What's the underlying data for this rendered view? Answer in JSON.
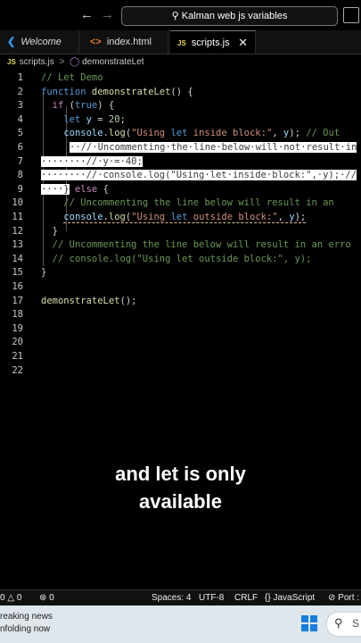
{
  "titlebar": {
    "back_icon": "arrow-left-icon",
    "forward_icon": "arrow-right-icon",
    "search_text": "Kalman web js variables"
  },
  "tabs": [
    {
      "label": "Welcome",
      "icon": "vscode-icon"
    },
    {
      "label": "index.html",
      "icon": "html-file-icon"
    },
    {
      "label": "scripts.js",
      "icon": "js-file-icon",
      "active": true
    }
  ],
  "breadcrumb": {
    "file": "scripts.js",
    "symbol": "demonstrateLet",
    "separator": ">"
  },
  "code_lines": [
    "// Let Demo",
    "function demonstrateLet() {",
    "if (true) {",
    "let y = 20;",
    "console.log(\"Using let inside block:\", y); // Out",
    "// Uncommenting the line below will not result in",
    "// y = 40;",
    "// console.log(\"Using let inside block:\", y); //",
    "} else {",
    "// Uncommenting the line below will result in an",
    "console.log(\"Using let outside block:\", y);",
    "}",
    "// Uncommenting the line below will result in an erro",
    "// console.log(\"Using let outside block:\", y);",
    "}",
    "",
    "demonstrateLet();",
    "",
    "",
    "",
    "",
    ""
  ],
  "line_numbers": [
    "1",
    "2",
    "3",
    "4",
    "5",
    "6",
    "7",
    "8",
    "9",
    "10",
    "11",
    "12",
    "13",
    "14",
    "15",
    "16",
    "17",
    "18",
    "19",
    "20",
    "21",
    "22"
  ],
  "caption": {
    "line1": "and let is only",
    "line2": "available"
  },
  "status": {
    "errors": "0",
    "warnings": "0",
    "ports": "0",
    "spaces": "Spaces: 4",
    "encoding": "UTF-8",
    "eol": "CRLF",
    "language": "JavaScript",
    "port": "Port :"
  },
  "taskbar": {
    "news_line1": "reaking news",
    "news_line2": "nfolding now",
    "search_label": "S"
  },
  "colors": {
    "comment": "#6a9955",
    "keyword": "#569cd6",
    "control": "#c586c0",
    "function": "#dcdcaa",
    "variable": "#9cdcfe",
    "number": "#b5cea8",
    "string": "#ce9178",
    "js_badge": "#e8d44d"
  }
}
